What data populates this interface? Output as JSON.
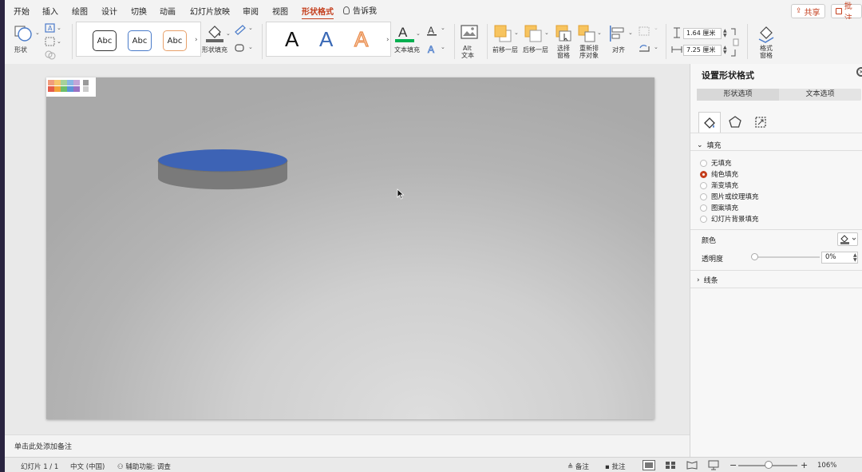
{
  "tabs": [
    "开始",
    "插入",
    "绘图",
    "设计",
    "切换",
    "动画",
    "幻灯片放映",
    "审阅",
    "视图",
    "形状格式"
  ],
  "active_tab": "形状格式",
  "tell_me": "告诉我",
  "share": "共享",
  "comments": "批注",
  "ribbon": {
    "shape": "形状",
    "style_samples": [
      "Abc",
      "Abc",
      "Abc"
    ],
    "shape_fill": "形状填充",
    "wordart": [
      "A",
      "A",
      "A"
    ],
    "text_fill": "文本填充",
    "alt_text": [
      "Alt",
      "文本"
    ],
    "bring_forward": "前移一层",
    "send_backward": "后移一层",
    "selection_pane": [
      "选择",
      "窗格"
    ],
    "reorder": [
      "重新排",
      "序对象"
    ],
    "align": "对齐",
    "height": "1.64 厘米",
    "width": "7.25 厘米",
    "format_pane": [
      "格式",
      "窗格"
    ]
  },
  "notes_placeholder": "单击此处添加备注",
  "pane": {
    "title": "设置形状格式",
    "segments": [
      "形状选项",
      "文本选项"
    ],
    "fill_section": "填充",
    "fill_options": [
      "无填充",
      "纯色填充",
      "渐变填充",
      "图片或纹理填充",
      "图案填充",
      "幻灯片背景填充"
    ],
    "selected_fill": "纯色填充",
    "color_label": "颜色",
    "transparency_label": "透明度",
    "transparency_value": "0%",
    "line_section": "线条"
  },
  "status": {
    "slide": "幻灯片 1 / 1",
    "language": "中文 (中国)",
    "accessibility": "辅助功能: 调查",
    "notes": "备注",
    "comments": "批注",
    "zoom": "106%",
    "zoom_level_percent": 106
  },
  "colors": {
    "accent": "#c43e1c",
    "cylinder_top": "#3d63b5",
    "cylinder_body": "#7a7a7a",
    "wordart_blue": "#3a69b6",
    "wordart_orange": "#e8a06a",
    "text_fill_bar": "#00b050"
  }
}
